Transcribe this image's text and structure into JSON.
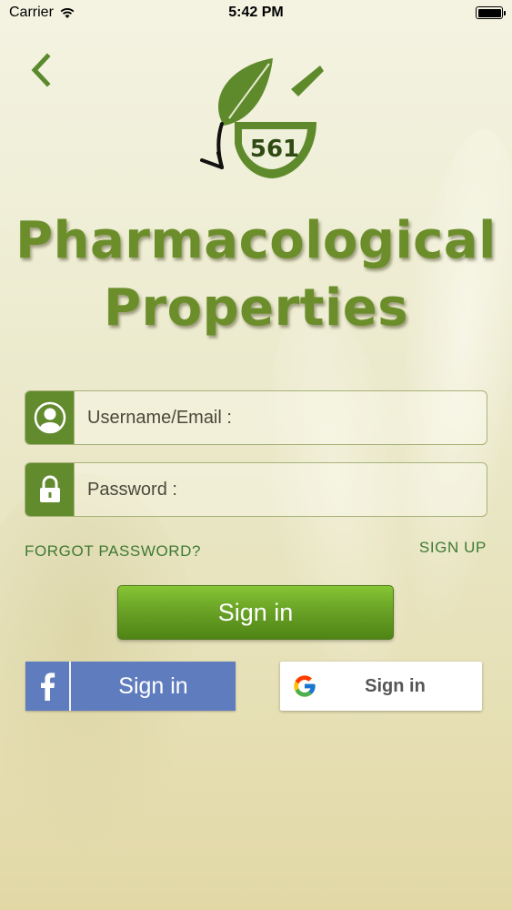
{
  "status_bar": {
    "carrier": "Carrier",
    "time": "5:42 PM"
  },
  "header": {
    "back_icon": "chevron-left-icon",
    "logo_number": "561"
  },
  "title": {
    "line1": "Pharmacological",
    "line2": "Properties"
  },
  "form": {
    "username_placeholder": "Username/Email :",
    "password_placeholder": "Password :",
    "forgot_password": "FORGOT PASSWORD?",
    "sign_up": "SIGN UP",
    "sign_in": "Sign in"
  },
  "social": {
    "facebook_label": "Sign in",
    "google_label": "Sign in"
  },
  "colors": {
    "brand_green": "#628b2e",
    "title_green": "#6b8e2b",
    "facebook_blue": "#5f7cbe"
  }
}
